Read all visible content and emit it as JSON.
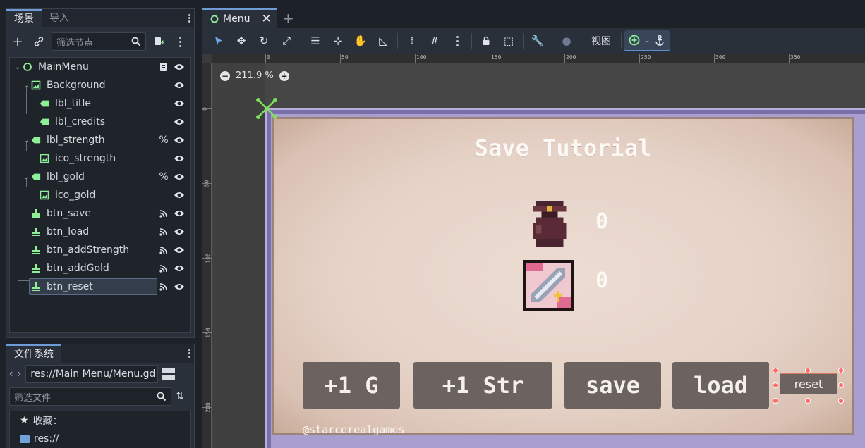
{
  "scene_dock": {
    "tabs": [
      "场景",
      "导入"
    ],
    "filter_placeholder": "筛选节点",
    "nodes": [
      {
        "name": "MainMenu",
        "icon": "control-node-icon",
        "extra": "script-icon"
      },
      {
        "name": "Background",
        "icon": "texture-rect-icon",
        "extra": ""
      },
      {
        "name": "lbl_title",
        "icon": "label-icon",
        "extra": ""
      },
      {
        "name": "lbl_credits",
        "icon": "label-icon",
        "extra": ""
      },
      {
        "name": "lbl_strength",
        "icon": "label-icon",
        "extra": "%"
      },
      {
        "name": "ico_strength",
        "icon": "texture-rect-icon",
        "extra": ""
      },
      {
        "name": "lbl_gold",
        "icon": "label-icon",
        "extra": "%"
      },
      {
        "name": "ico_gold",
        "icon": "texture-rect-icon",
        "extra": ""
      },
      {
        "name": "btn_save",
        "icon": "button-icon",
        "extra": "signal-icon"
      },
      {
        "name": "btn_load",
        "icon": "button-icon",
        "extra": "signal-icon"
      },
      {
        "name": "btn_addStrength",
        "icon": "button-icon",
        "extra": "signal-icon"
      },
      {
        "name": "btn_addGold",
        "icon": "button-icon",
        "extra": "signal-icon"
      },
      {
        "name": "btn_reset",
        "icon": "button-icon",
        "extra": "signal-icon",
        "selected": true
      }
    ]
  },
  "fs_dock": {
    "tab": "文件系统",
    "path": "res://Main Menu/Menu.gd",
    "filter_placeholder": "筛选文件",
    "favorites": "收藏：",
    "root": "res://"
  },
  "editor": {
    "tab_title": "Menu",
    "view_label": "视图",
    "zoom": "211.9 %",
    "ruler_top": [
      "0",
      "50",
      "100",
      "150",
      "200",
      "250",
      "300",
      "350"
    ],
    "ruler_left": [
      "0",
      "50",
      "100",
      "150",
      "200"
    ]
  },
  "game": {
    "title": "Save Tutorial",
    "gold_value": "0",
    "strength_value": "0",
    "buttons": {
      "add_gold": "+1 G",
      "add_str": "+1 Str",
      "save": "save",
      "load": "load",
      "reset": "reset"
    },
    "credit": "@starcerealgames"
  },
  "colors": {
    "accent": "#6f9cd8",
    "selection": "#333d4b",
    "game_button": "#6c6260",
    "frame": "#7a6fa6"
  }
}
